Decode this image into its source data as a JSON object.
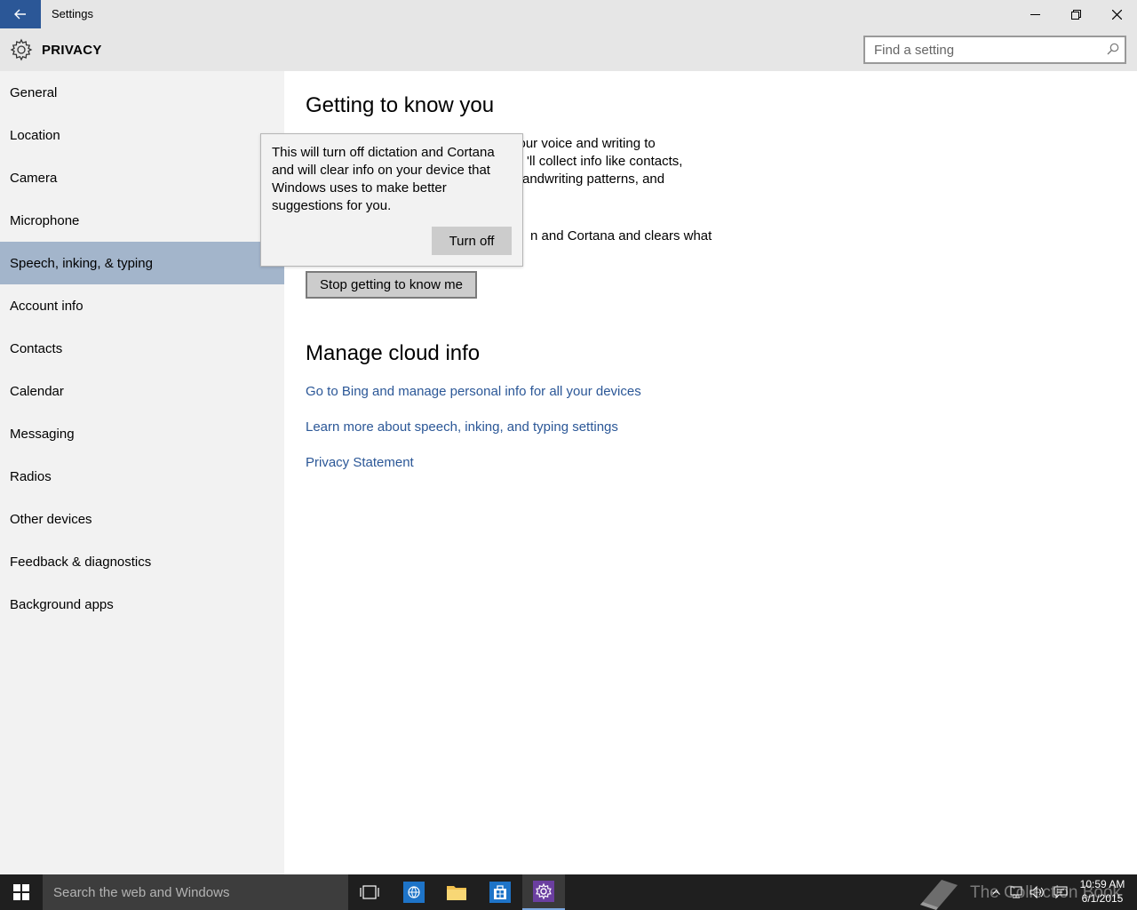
{
  "window": {
    "title": "Settings",
    "back_icon": "back-arrow-icon",
    "minimize_icon": "minimize-icon",
    "restore_icon": "restore-icon",
    "close_icon": "close-icon"
  },
  "header": {
    "title": "PRIVACY",
    "icon": "gear-icon",
    "search_placeholder": "Find a setting"
  },
  "sidebar": {
    "selected_index": 4,
    "items": [
      {
        "label": "General"
      },
      {
        "label": "Location"
      },
      {
        "label": "Camera"
      },
      {
        "label": "Microphone"
      },
      {
        "label": "Speech, inking, & typing"
      },
      {
        "label": "Account info"
      },
      {
        "label": "Contacts"
      },
      {
        "label": "Calendar"
      },
      {
        "label": "Messaging"
      },
      {
        "label": "Radios"
      },
      {
        "label": "Other devices"
      },
      {
        "label": "Feedback & diagnostics"
      },
      {
        "label": "Background apps"
      }
    ]
  },
  "main": {
    "section1_title": "Getting to know you",
    "section1_para1_lines": [
      "w your voice and writing to",
      "'ll collect info like contacts,",
      "andwriting patterns, and"
    ],
    "section1_para2": "n and Cortana and clears what",
    "stop_button": "Stop getting to know me",
    "section2_title": "Manage cloud info",
    "links": [
      "Go to Bing and manage personal info for all your devices",
      "Learn more about speech, inking, and typing settings",
      "Privacy Statement"
    ]
  },
  "flyout": {
    "text": "This will turn off dictation and Cortana and will clear info on your device that Windows uses to make better suggestions for you.",
    "button": "Turn off"
  },
  "taskbar": {
    "search_placeholder": "Search the web and Windows",
    "watermark": "The Collection Book",
    "time": "10:59 AM",
    "date": "6/1/2015",
    "accent": "#2b5797"
  }
}
